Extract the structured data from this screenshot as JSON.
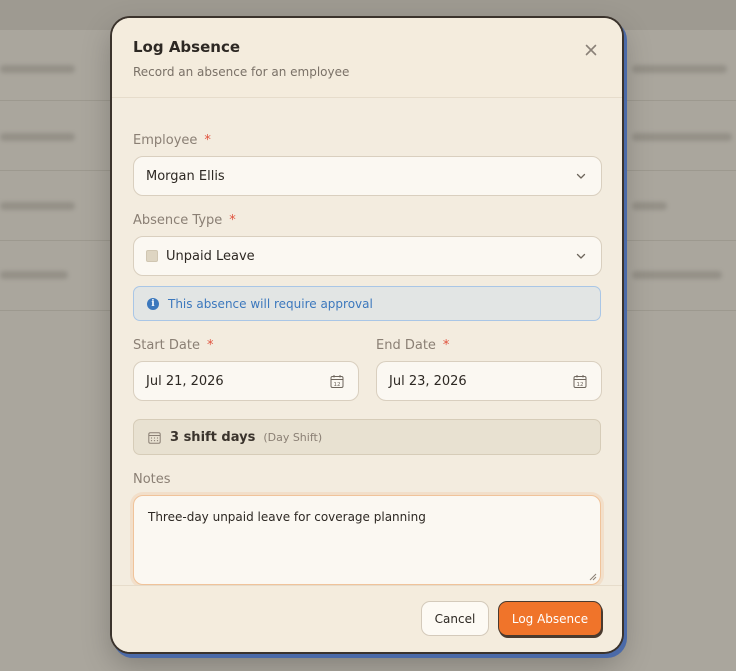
{
  "dialog": {
    "title": "Log Absence",
    "subtitle": "Record an absence for an employee"
  },
  "employee": {
    "label": "Employee",
    "required_mark": "*",
    "value": "Morgan Ellis"
  },
  "absence_type": {
    "label": "Absence Type",
    "required_mark": "*",
    "value": "Unpaid Leave",
    "swatch_color": "#ded5c2"
  },
  "approval_notice": {
    "text": "This absence will require approval",
    "icon": "info-icon",
    "icon_glyph": "i",
    "color": "#3c78bd"
  },
  "start_date": {
    "label": "Start Date",
    "required_mark": "*",
    "value": "Jul 21, 2026",
    "calendar_day": "12"
  },
  "end_date": {
    "label": "End Date",
    "required_mark": "*",
    "value": "Jul 23, 2026",
    "calendar_day": "12"
  },
  "shift_summary": {
    "count_text": "3 shift days",
    "shift_name": "(Day Shift)"
  },
  "notes": {
    "label": "Notes",
    "value": "Three-day unpaid leave for coverage planning"
  },
  "footer": {
    "cancel_label": "Cancel",
    "submit_label": "Log Absence",
    "accent_color": "#f0742a"
  }
}
